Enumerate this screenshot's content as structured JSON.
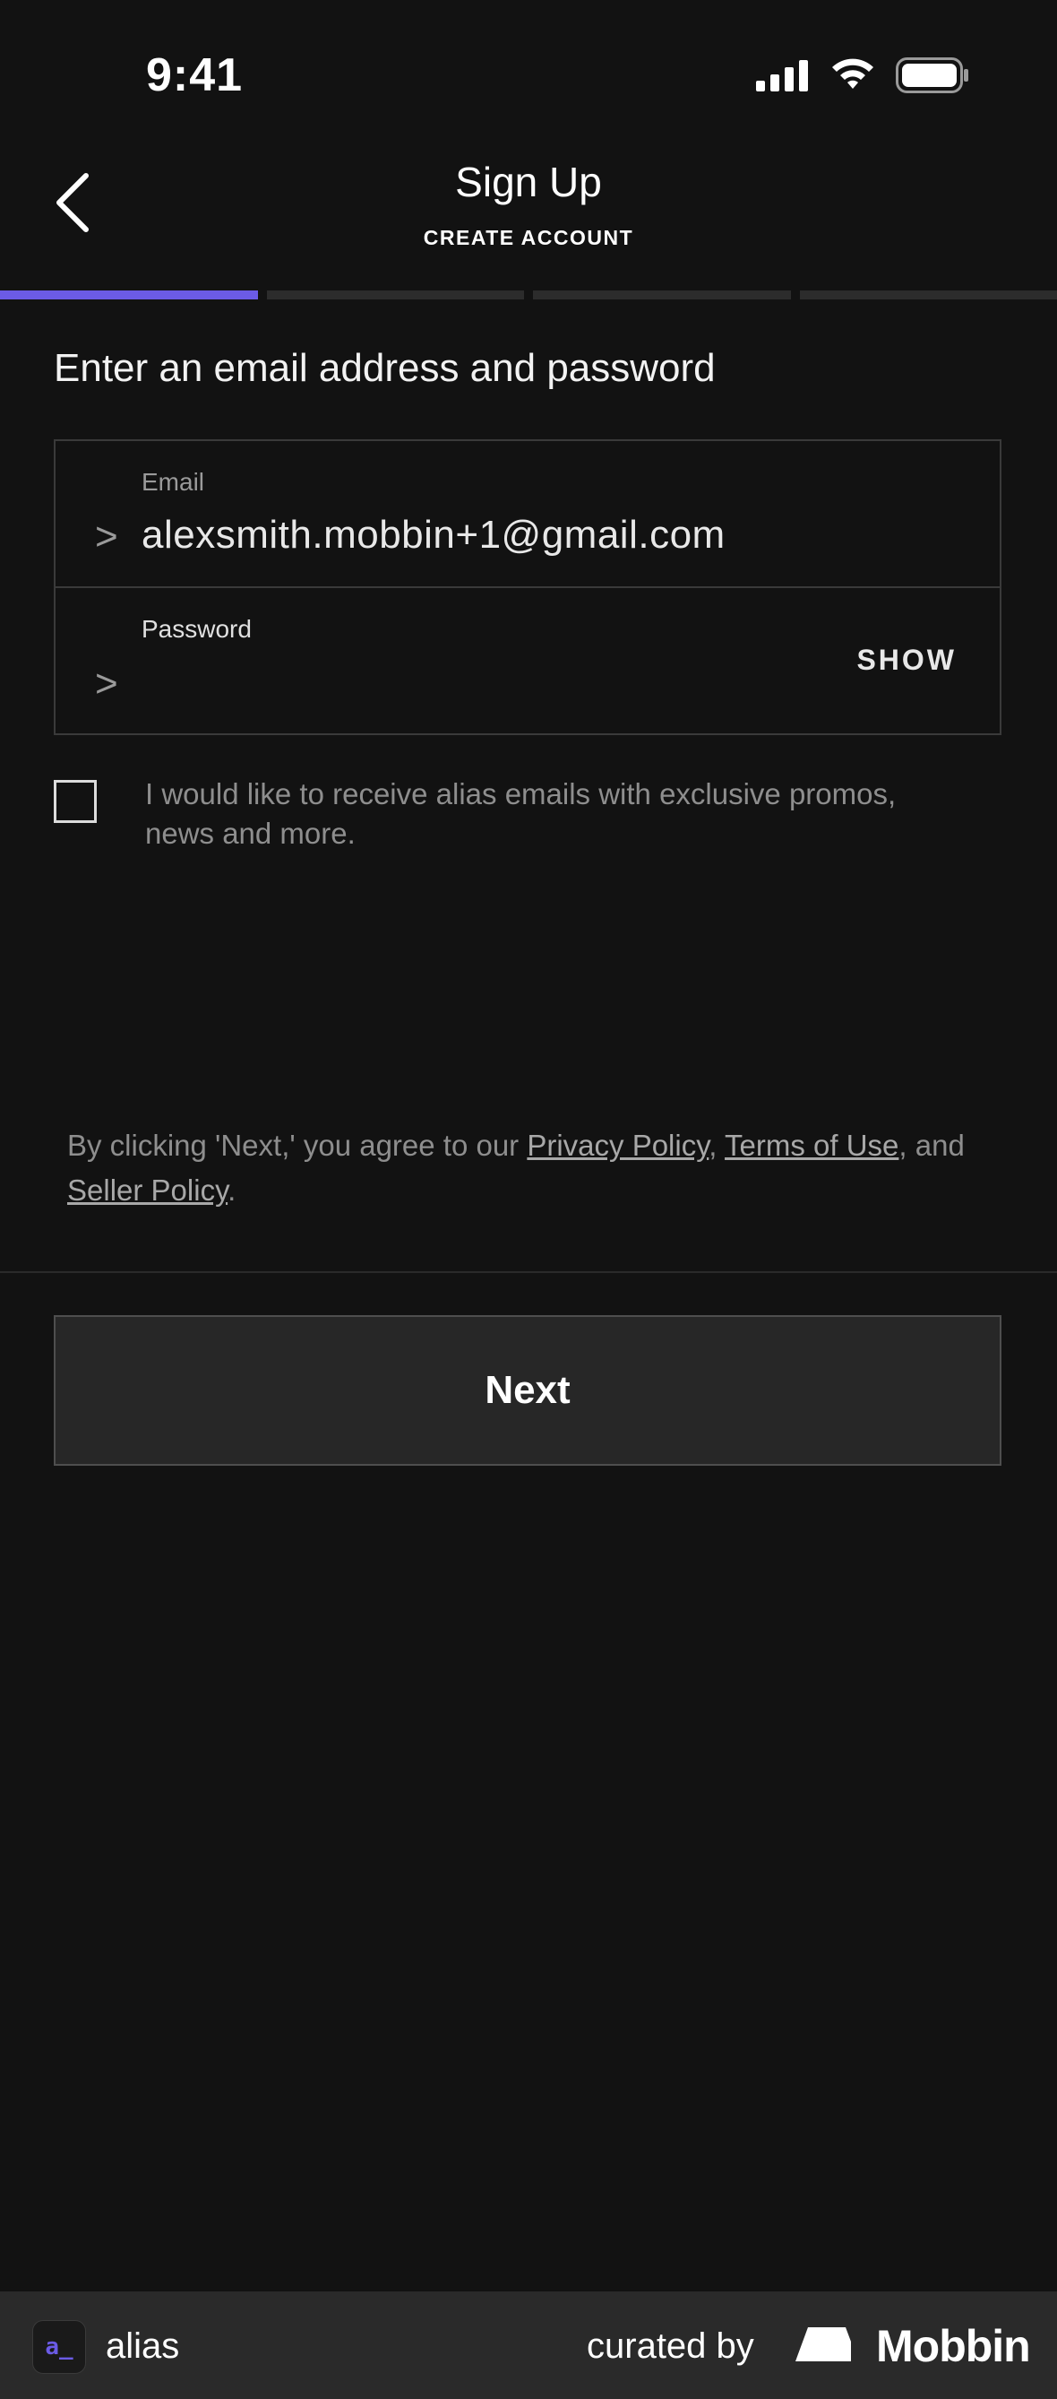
{
  "status_bar": {
    "time": "9:41",
    "icons": [
      "signal-icon",
      "wifi-icon",
      "battery-icon"
    ]
  },
  "header": {
    "title": "Sign Up",
    "subtitle": "CREATE ACCOUNT",
    "back_icon": "chevron-left-icon"
  },
  "progress": {
    "current_step": 1,
    "total_steps": 4,
    "active_color": "#6b5be6"
  },
  "form": {
    "heading": "Enter an email address and password",
    "email": {
      "label": "Email",
      "prompt": ">",
      "value": "alexsmith.mobbin+1@gmail.com"
    },
    "password": {
      "label": "Password",
      "prompt": ">",
      "value": "",
      "show_label": "SHOW"
    },
    "opt_in": {
      "checked": false,
      "label": "I would like to receive alias emails with exclusive promos, news and more."
    }
  },
  "legal": {
    "prefix": "By clicking 'Next,' you agree to our ",
    "privacy": "Privacy Policy",
    "sep1": ", ",
    "terms": "Terms of Use",
    "sep2": ", and ",
    "seller": "Seller Policy",
    "suffix": "."
  },
  "next_button": {
    "label": "Next"
  },
  "footer": {
    "app_icon_text": "a_",
    "app_name": "alias",
    "curated_by": "curated by",
    "brand": "Mobbin"
  }
}
